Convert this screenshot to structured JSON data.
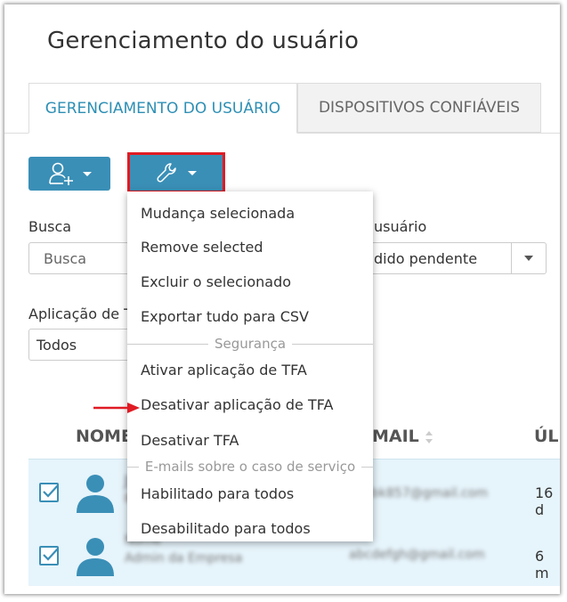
{
  "page": {
    "title": "Gerenciamento do usuário"
  },
  "tabs": [
    {
      "label": "GERENCIAMENTO DO USUÁRIO",
      "active": true
    },
    {
      "label": "DISPOSITIVOS CONFIÁVEIS",
      "active": false
    }
  ],
  "toolbar": {
    "add_user_icon": "user-add-icon",
    "tools_icon": "wrench-icon"
  },
  "filters": {
    "search_label": "Busca",
    "search_placeholder": "Busca",
    "status_label_tail": "usuário",
    "status_value_tail": "dido pendente",
    "app_label_head": "Aplicação de T",
    "app_value": "Todos"
  },
  "table": {
    "headers": {
      "name": "NOME",
      "email": "MAIL",
      "last": "ÚL"
    },
    "rows": [
      {
        "checked": true,
        "name": "J",
        "email": "a.bk857@gmail.com",
        "last": "16 d"
      },
      {
        "checked": true,
        "name": "Nome",
        "subtitle": "Admin da Empresa",
        "email": "abcdefgh@gmail.com",
        "last": "6 m"
      }
    ]
  },
  "menu": {
    "items_top": [
      "Mudança selecionada",
      "Remove selected",
      "Excluir o selecionado",
      "Exportar tudo para CSV"
    ],
    "section_security": "Segurança",
    "items_security": [
      "Ativar aplicação de TFA",
      "Desativar aplicação de TFA",
      "Desativar TFA"
    ],
    "section_emails": "E-mails sobre o caso de serviço",
    "items_emails": [
      "Habilitado para todos",
      "Desabilitado para todos"
    ]
  },
  "colors": {
    "accent": "#3a8fb7",
    "highlight": "#e01b24",
    "row_bg": "#e6f4fb"
  }
}
